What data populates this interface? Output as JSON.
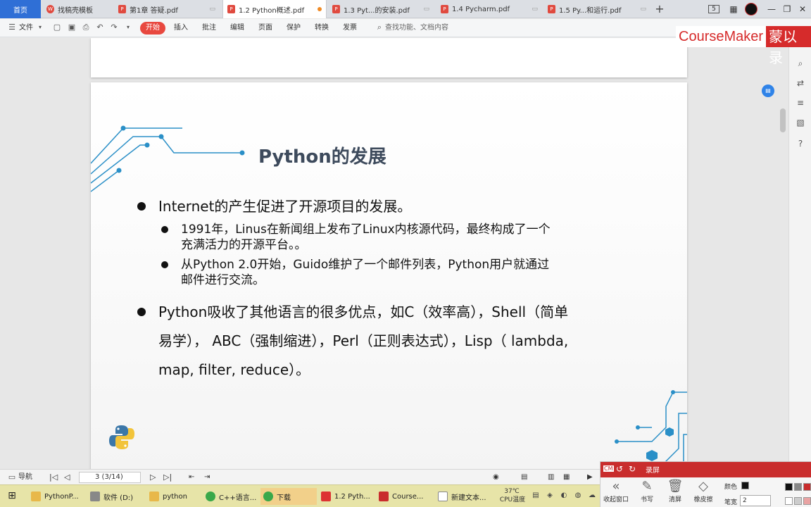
{
  "tabs": {
    "home": "首页",
    "items": [
      {
        "label": "找稿壳模板"
      },
      {
        "label": "第1章 答疑.pdf"
      },
      {
        "label": "1.2 Python概述.pdf"
      },
      {
        "label": "1.3 Pyt...的安装.pdf"
      },
      {
        "label": "1.4 Pycharm.pdf"
      },
      {
        "label": "1.5 Py...和运行.pdf"
      }
    ],
    "new_tab": "+"
  },
  "window": {
    "badge": "5",
    "minimize": "—",
    "restore": "❐",
    "close": "✕"
  },
  "toolbar": {
    "file": "文件",
    "start": "开始",
    "insert": "插入",
    "annotate": "批注",
    "edit": "编辑",
    "page": "页面",
    "protect": "保护",
    "convert": "转换",
    "invoice": "发票",
    "search_placeholder": "查找功能、文档内容"
  },
  "brand": {
    "name": "CourseMaker",
    "user": "蒙以录"
  },
  "slide": {
    "title": "Python的发展",
    "b1": "Internet的产生促进了开源项目的发展。",
    "b1_1_l1": "1991年，Linus在新闻组上发布了Linux内核源代码，最终构成了一个",
    "b1_1_l2": "充满活力的开源平台。。",
    "b1_2_l1": "从Python 2.0开始，Guido维护了一个邮件列表，Python用户就通过",
    "b1_2_l2": "邮件进行交流。",
    "b2_l1": "Python吸收了其他语言的很多优点，如C（效率高），Shell（简单",
    "b2_l2": "易学）， ABC（强制缩进），Perl（正则表达式），Lisp（ lambda,",
    "b2_l3": "map, filter, reduce）。"
  },
  "status": {
    "nav": "导航",
    "page_indicator": "3 (3/14)"
  },
  "taskbar": {
    "items": [
      {
        "label": "PythonP..."
      },
      {
        "label": "软件 (D:)"
      },
      {
        "label": "python"
      },
      {
        "label": "C++语言..."
      },
      {
        "label": "下载"
      },
      {
        "label": "1.2 Pyth..."
      },
      {
        "label": "Course..."
      },
      {
        "label": "新建文本..."
      }
    ],
    "temp": "37℃",
    "temp_label": "CPU温度"
  },
  "recorder": {
    "title": "录屏",
    "collapse": "收起窗口",
    "write": "书写",
    "clear": "清屏",
    "eraser": "橡皮擦",
    "color_label": "颜色",
    "pen_width_label": "笔宽",
    "pen_width_value": "2"
  },
  "colors": {
    "accent_red": "#d62b2b",
    "wps_blue": "#2f6fd6",
    "slide_title": "#3d4a5c",
    "line_blue": "#2a8fc7"
  }
}
